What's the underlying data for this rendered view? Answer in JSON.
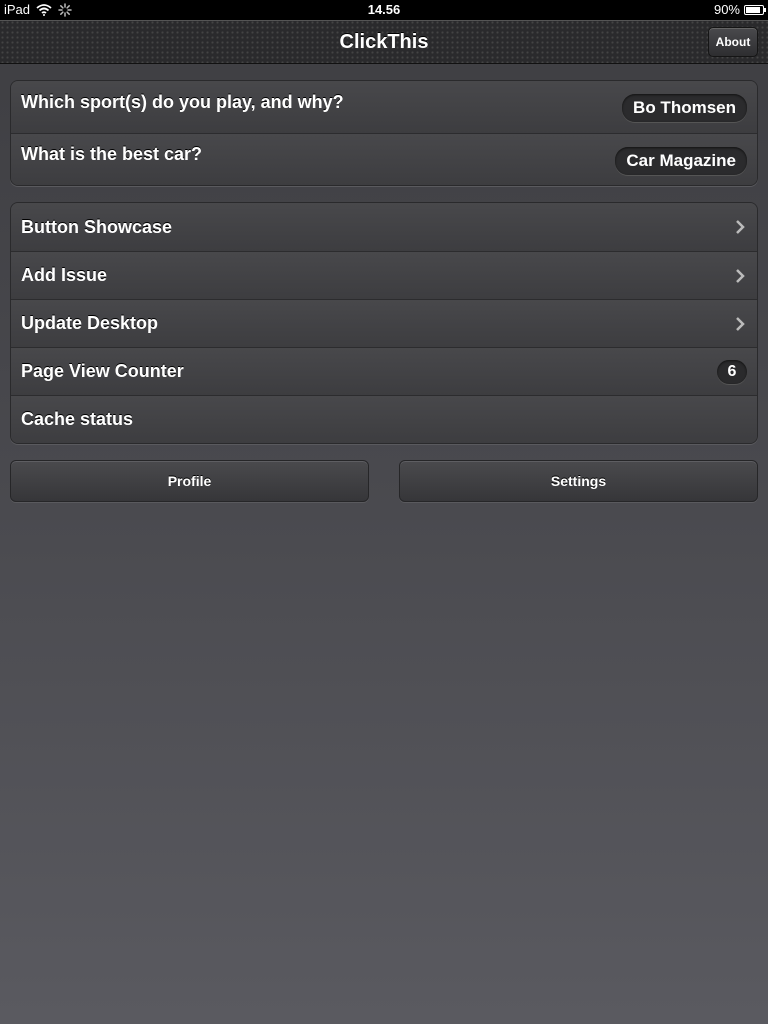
{
  "status_bar": {
    "device": "iPad",
    "time": "14.56",
    "battery": "90%",
    "battery_level": 0.9,
    "icons": [
      "wifi-icon",
      "activity-spinner-icon",
      "battery-icon"
    ]
  },
  "navbar": {
    "title": "ClickThis",
    "about_label": "About"
  },
  "questions": [
    {
      "label": "Which sport(s) do you play, and why?",
      "value": "Bo Thomsen"
    },
    {
      "label": "What is the best car?",
      "value": "Car Magazine"
    }
  ],
  "menu": [
    {
      "label": "Button Showcase",
      "accessory": "chevron-right-icon"
    },
    {
      "label": "Add Issue",
      "accessory": "chevron-right-icon"
    },
    {
      "label": "Update Desktop",
      "accessory": "chevron-right-icon"
    },
    {
      "label": "Page View Counter",
      "badge": "6"
    },
    {
      "label": "Cache status"
    }
  ],
  "buttons": {
    "profile": "Profile",
    "settings": "Settings"
  },
  "colors": {
    "navbar": "#2a2a2c",
    "background": "#4a4a4f",
    "row": "#444447",
    "text": "#ffffff"
  }
}
